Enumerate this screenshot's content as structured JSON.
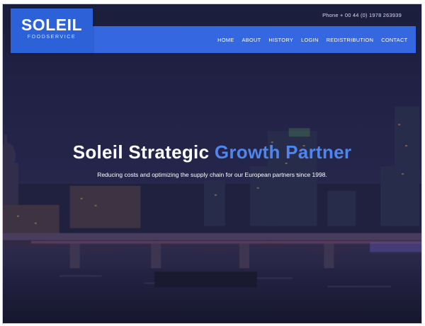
{
  "header": {
    "phone": "Phone + 00 44 (0) 1978 263939",
    "logo": {
      "name": "SOLEIL",
      "tagline": "FOODSERVICE"
    }
  },
  "nav": {
    "items": [
      "HOME",
      "ABOUT",
      "HISTORY",
      "LOGIN",
      "REDISTRIBUTION",
      "CONTACT"
    ]
  },
  "hero": {
    "title_part1": "Soleil Strategic",
    "title_part2": "Growth Partner",
    "subtitle": "Reducing costs and optimizing the supply chain for our European partners since 1998."
  },
  "colors": {
    "brand_blue": "#3467e0",
    "accent_blue": "#4f86ec",
    "night_sky": "#1f2142"
  },
  "background_image": "night-city-skyline-bridge"
}
